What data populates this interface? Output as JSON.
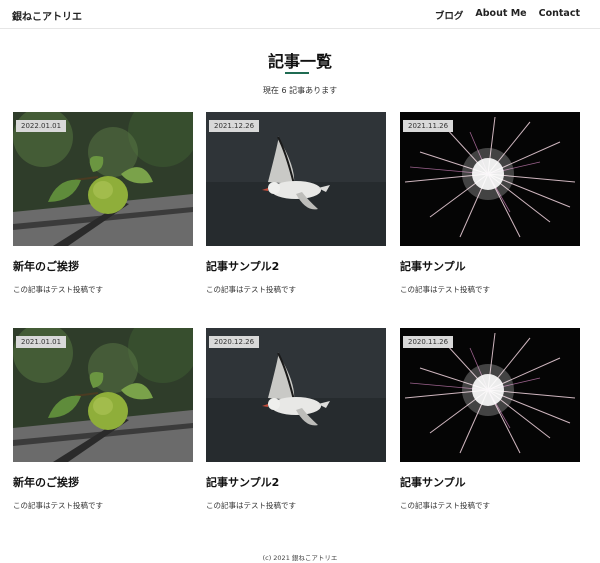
{
  "header": {
    "site_title": "銀ねこアトリエ",
    "nav": [
      "ブログ",
      "About Me",
      "Contact"
    ]
  },
  "main": {
    "title": "記事一覧",
    "post_count": "現在 6 記事あります",
    "accent_color": "#1f6b52",
    "posts": [
      {
        "date": "2022.01.01",
        "title": "新年のご挨拶",
        "excerpt": "この記事はテスト投稿です",
        "image": "apple"
      },
      {
        "date": "2021.12.26",
        "title": "記事サンプル2",
        "excerpt": "この記事はテスト投稿です",
        "image": "seagull"
      },
      {
        "date": "2021.11.26",
        "title": "記事サンプル",
        "excerpt": "この記事はテスト投稿です",
        "image": "sparkler"
      },
      {
        "date": "2021.01.01",
        "title": "新年のご挨拶",
        "excerpt": "この記事はテスト投稿です",
        "image": "apple"
      },
      {
        "date": "2020.12.26",
        "title": "記事サンプル2",
        "excerpt": "この記事はテスト投稿です",
        "image": "seagull"
      },
      {
        "date": "2020.11.26",
        "title": "記事サンプル",
        "excerpt": "この記事はテスト投稿です",
        "image": "sparkler"
      }
    ]
  },
  "footer": {
    "copyright": "(c) 2021 銀ねこアトリエ"
  }
}
